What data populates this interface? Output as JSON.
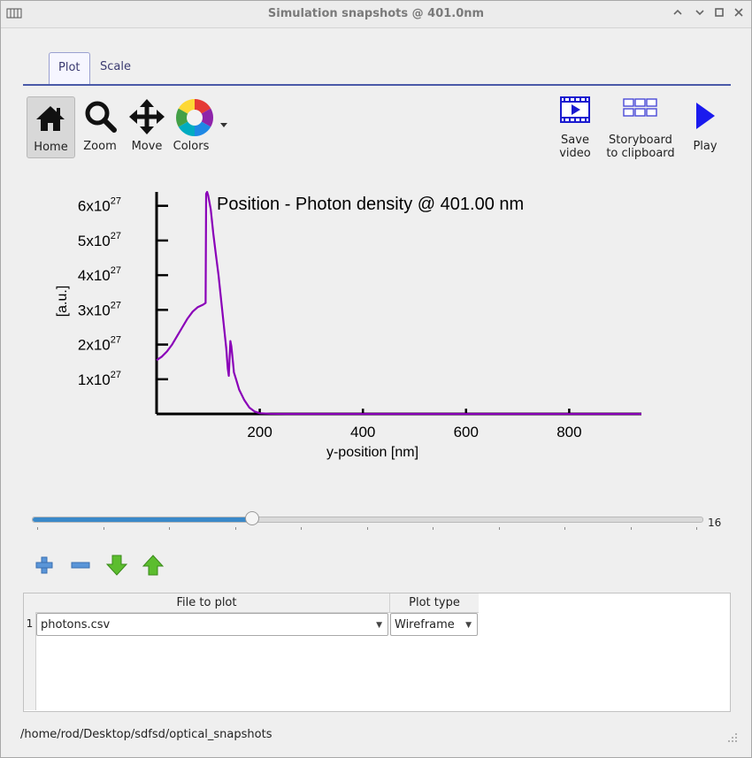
{
  "window": {
    "title": "Simulation snapshots @ 401.0nm"
  },
  "tabs": [
    {
      "label": "Plot"
    },
    {
      "label": "Scale"
    }
  ],
  "toolbar": {
    "home": "Home",
    "zoom": "Zoom",
    "move": "Move",
    "colors": "Colors",
    "save_video_l1": "Save",
    "save_video_l2": "video",
    "storyboard_l1": "Storyboard",
    "storyboard_l2": "to clipboard",
    "play": "Play"
  },
  "chart_data": {
    "type": "line",
    "title": "Position - Photon density @ 401.00 nm",
    "xlabel": "y-position [nm]",
    "ylabel": "[a.u.]",
    "xlim": [
      0,
      940
    ],
    "ylim": [
      0,
      6.4e+27
    ],
    "xticks": [
      {
        "value": 200,
        "label": "200"
      },
      {
        "value": 400,
        "label": "400"
      },
      {
        "value": 600,
        "label": "600"
      },
      {
        "value": 800,
        "label": "800"
      }
    ],
    "yticks": [
      {
        "value": 1e+27,
        "mant": "1x10",
        "exp": "27"
      },
      {
        "value": 2e+27,
        "mant": "2x10",
        "exp": "27"
      },
      {
        "value": 3e+27,
        "mant": "3x10",
        "exp": "27"
      },
      {
        "value": 4e+27,
        "mant": "4x10",
        "exp": "27"
      },
      {
        "value": 5e+27,
        "mant": "5x10",
        "exp": "27"
      },
      {
        "value": 6e+27,
        "mant": "6x10",
        "exp": "27"
      }
    ],
    "series": [
      {
        "color": "#8a00b8",
        "x": [
          0,
          10,
          20,
          30,
          40,
          50,
          60,
          70,
          80,
          90,
          95,
          96,
          98,
          100,
          105,
          110,
          115,
          120,
          125,
          130,
          135,
          138,
          140,
          143,
          145,
          148,
          150,
          155,
          160,
          170,
          180,
          190,
          200,
          220,
          250,
          300,
          400,
          500,
          600,
          700,
          800,
          900,
          940
        ],
        "y": [
          1.55e+27,
          1.65e+27,
          1.8e+27,
          2e+27,
          2.25e+27,
          2.5e+27,
          2.75e+27,
          2.95e+27,
          3.08e+27,
          3.15e+27,
          3.2e+27,
          6.35e+27,
          6.4e+27,
          6.3e+27,
          5.9e+27,
          5.2e+27,
          4.6e+27,
          4e+27,
          3.3e+27,
          2.6e+27,
          1.9e+27,
          1.3e+27,
          1.1e+27,
          2.1e+27,
          1.95e+27,
          1.5e+27,
          1.2e+27,
          9.5e+26,
          7e+26,
          4e+26,
          1.8e+26,
          7e+25,
          2e+25,
          4e+24,
          0,
          0,
          0,
          0,
          0,
          0,
          0,
          0,
          0
        ]
      }
    ],
    "grid": false,
    "legend": "none"
  },
  "slider": {
    "value": 16,
    "min": 0,
    "max": 50,
    "fraction": 0.327
  },
  "table": {
    "headers": [
      "File to plot",
      "Plot type"
    ],
    "rows": [
      {
        "index": "1",
        "file": "photons.csv",
        "plot_type": "Wireframe"
      }
    ]
  },
  "status": {
    "path": "/home/rod/Desktop/sdfsd/optical_snapshots"
  }
}
